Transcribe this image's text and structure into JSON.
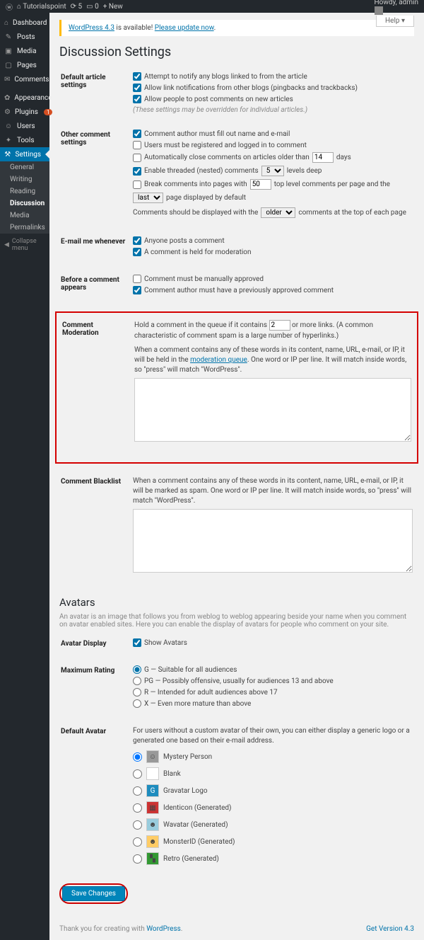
{
  "adminbar": {
    "site_name": "Tutorialspoint",
    "comment_count": "5",
    "pending": "0",
    "new_label": "New",
    "howdy": "Howdy, admin"
  },
  "help_label": "Help ▾",
  "nag": {
    "pre": "WordPress 4.3",
    "mid": " is available! ",
    "link": "Please update now",
    "post": "."
  },
  "page_title": "Discussion Settings",
  "sidebar": {
    "items": [
      {
        "icon": "⌂",
        "label": "Dashboard"
      },
      {
        "icon": "✎",
        "label": "Posts"
      },
      {
        "icon": "▣",
        "label": "Media"
      },
      {
        "icon": "▢",
        "label": "Pages"
      },
      {
        "icon": "✉",
        "label": "Comments"
      },
      {
        "icon": "sep",
        "label": ""
      },
      {
        "icon": "✿",
        "label": "Appearance"
      },
      {
        "icon": "⚙",
        "label": "Plugins",
        "badge": "1"
      },
      {
        "icon": "☺",
        "label": "Users"
      },
      {
        "icon": "✦",
        "label": "Tools"
      },
      {
        "icon": "⚒",
        "label": "Settings",
        "active": true
      }
    ],
    "sub": [
      "General",
      "Writing",
      "Reading",
      "Discussion",
      "Media",
      "Permalinks"
    ],
    "sub_current": "Discussion",
    "collapse": "Collapse menu"
  },
  "sections": {
    "article": {
      "th": "Default article settings",
      "o1": "Attempt to notify any blogs linked to from the article",
      "o2": "Allow link notifications from other blogs (pingbacks and trackbacks)",
      "o3": "Allow people to post comments on new articles",
      "note": "(These settings may be overridden for individual articles.)"
    },
    "other": {
      "th": "Other comment settings",
      "o1": "Comment author must fill out name and e-mail",
      "o2": "Users must be registered and logged in to comment",
      "o3_pre": "Automatically close comments on articles older than",
      "o3_val": "14",
      "o3_post": "days",
      "o4_pre": "Enable threaded (nested) comments",
      "o4_val": "5",
      "o4_post": "levels deep",
      "o5_pre": "Break comments into pages with",
      "o5_val": "50",
      "o5_mid": "top level comments per page and the",
      "o5_sel": "last",
      "o5_post": "page displayed by default",
      "o6_pre": "Comments should be displayed with the",
      "o6_sel": "older",
      "o6_post": "comments at the top of each page"
    },
    "email": {
      "th": "E-mail me whenever",
      "o1": "Anyone posts a comment",
      "o2": "A comment is held for moderation"
    },
    "before": {
      "th": "Before a comment appears",
      "o1": "Comment must be manually approved",
      "o2": "Comment author must have a previously approved comment"
    },
    "mod": {
      "th": "Comment Moderation",
      "p1_pre": "Hold a comment in the queue if it contains",
      "p1_val": "2",
      "p1_post": "or more links. (A common characteristic of comment spam is a large number of hyperlinks.)",
      "p2_pre": "When a comment contains any of these words in its content, name, URL, e-mail, or IP, it will be held in the ",
      "p2_link": "moderation queue",
      "p2_post": ". One word or IP per line. It will match inside words, so \"press\" will match \"WordPress\"."
    },
    "blacklist": {
      "th": "Comment Blacklist",
      "p": "When a comment contains any of these words in its content, name, URL, e-mail, or IP, it will be marked as spam. One word or IP per line. It will match inside words, so \"press\" will match \"WordPress\"."
    },
    "avatars": {
      "title": "Avatars",
      "desc": "An avatar is an image that follows you from weblog to weblog appearing beside your name when you comment on avatar enabled sites. Here you can enable the display of avatars for people who comment on your site.",
      "display_th": "Avatar Display",
      "display_opt": "Show Avatars",
      "rating_th": "Maximum Rating",
      "r1": "G — Suitable for all audiences",
      "r2": "PG — Possibly offensive, usually for audiences 13 and above",
      "r3": "R — Intended for adult audiences above 17",
      "r4": "X — Even more mature than above",
      "default_th": "Default Avatar",
      "default_desc": "For users without a custom avatar of their own, you can either display a generic logo or a generated one based on their e-mail address.",
      "d1": "Mystery Person",
      "d2": "Blank",
      "d3": "Gravatar Logo",
      "d4": "Identicon (Generated)",
      "d5": "Wavatar (Generated)",
      "d6": "MonsterID (Generated)",
      "d7": "Retro (Generated)"
    }
  },
  "save_label": "Save Changes",
  "footer": {
    "thank_pre": "Thank you for creating with ",
    "thank_link": "WordPress",
    "version": "Get Version 4.3"
  }
}
